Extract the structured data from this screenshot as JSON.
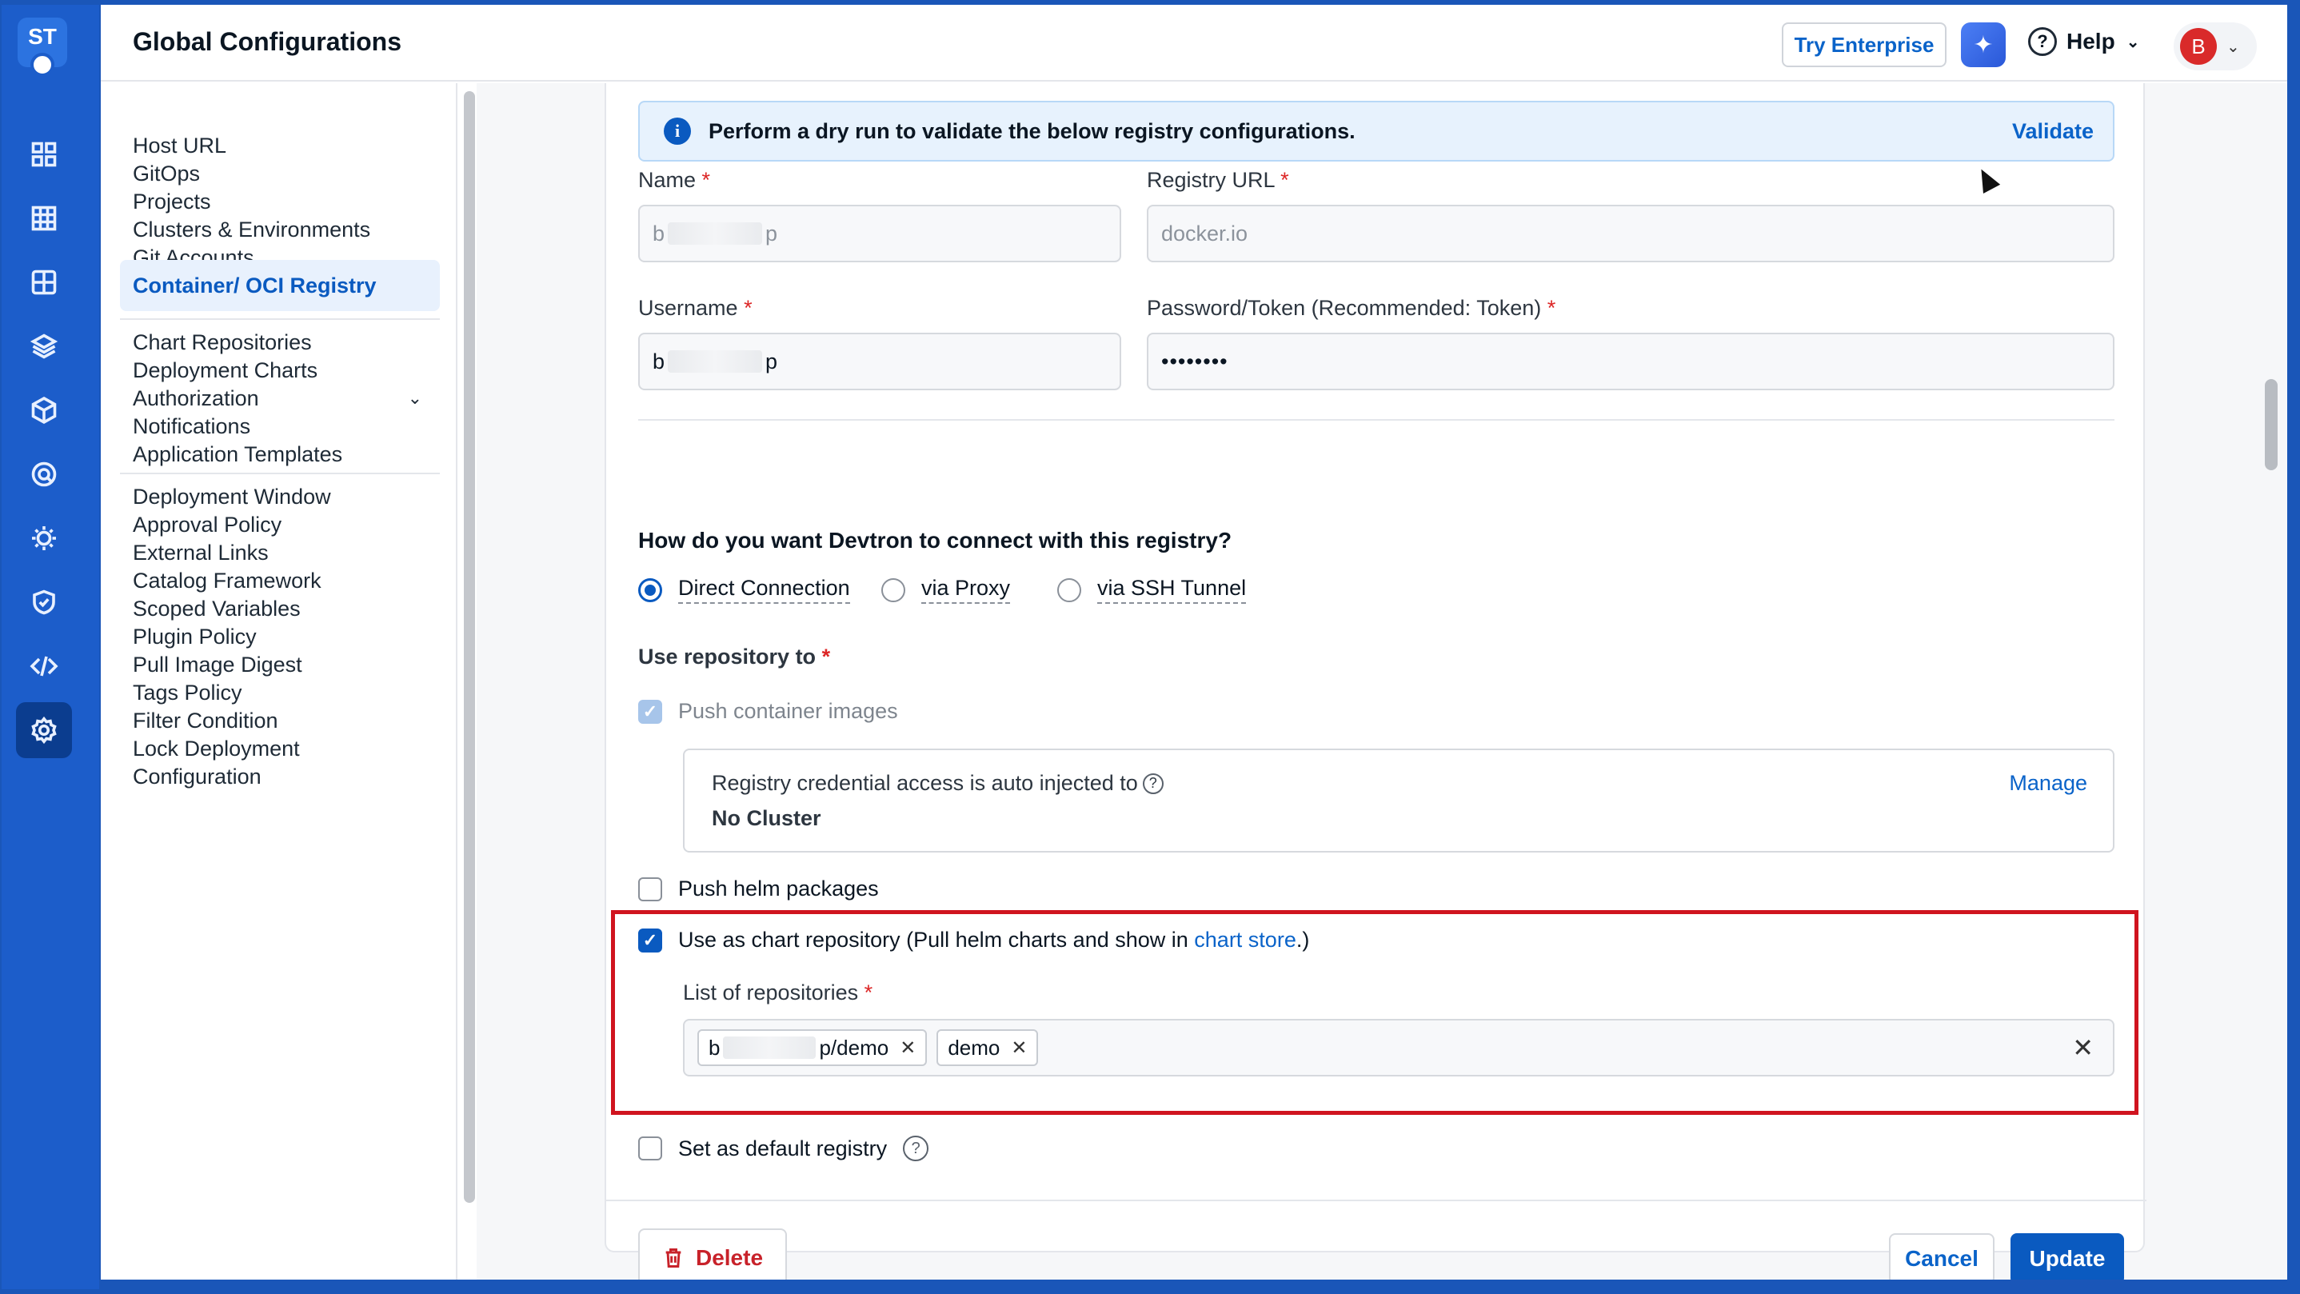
{
  "app": {
    "logo_text": "ST"
  },
  "header": {
    "title": "Global Configurations",
    "try_enterprise": "Try Enterprise",
    "help": "Help",
    "avatar_initial": "B"
  },
  "rail": {
    "icons": [
      "overview-icon",
      "applications-icon",
      "app-groups-icon",
      "stacks-icon",
      "resource-browser-icon",
      "security-icon",
      "bulk-edit-icon",
      "shield-icon",
      "code-icon",
      "settings-icon"
    ]
  },
  "settings_nav": {
    "group1": [
      "Host URL",
      "GitOps",
      "Projects",
      "Clusters & Environments",
      "Git Accounts",
      "Container/ OCI Registry"
    ],
    "group2": [
      "Chart Repositories",
      "Deployment Charts",
      "Authorization",
      "Notifications",
      "Application Templates"
    ],
    "group3": [
      "Deployment Window",
      "Approval Policy",
      "External Links",
      "Catalog Framework",
      "Scoped Variables",
      "Plugin Policy",
      "Pull Image Digest",
      "Tags Policy",
      "Filter Condition",
      "Lock Deployment",
      "Configuration"
    ],
    "active": "Container/ OCI Registry"
  },
  "form": {
    "info_message": "Perform a dry run to validate the below registry configurations.",
    "validate": "Validate",
    "name_label": "Name",
    "name_value_start": "b",
    "name_value_end": "p",
    "registry_url_label": "Registry URL",
    "registry_url_value": "docker.io",
    "username_label": "Username",
    "username_value_start": "b",
    "username_value_end": "p",
    "password_label": "Password/Token (Recommended: Token)",
    "password_value": "••••••••",
    "required_mark": "*",
    "connect_question": "How do you want Devtron to connect with this registry?",
    "connection_options": [
      "Direct Connection",
      "via Proxy",
      "via SSH Tunnel"
    ],
    "connection_selected": "Direct Connection",
    "use_repo_label": "Use repository to",
    "push_container_images": "Push container images",
    "inject_text": "Registry credential access is auto injected to",
    "inject_value": "No Cluster",
    "manage": "Manage",
    "push_helm_packages": "Push helm packages",
    "chart_repo_prefix": "Use as chart repository (Pull helm charts and show in ",
    "chart_repo_link": "chart store",
    "chart_repo_suffix": ".)",
    "repo_list_label": "List of repositories",
    "repo_tag1_start": "b",
    "repo_tag1_end": "p/demo",
    "repo_tag2": "demo",
    "default_registry": "Set as default registry",
    "delete": "Delete",
    "cancel": "Cancel",
    "update": "Update"
  },
  "colors": {
    "accent": "#0a5ac0",
    "rail": "#1c5dca",
    "highlight": "#d0141f",
    "danger": "#c8222a"
  }
}
